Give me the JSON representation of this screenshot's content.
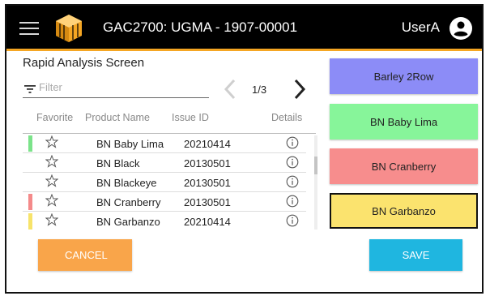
{
  "header": {
    "title": "GAC2700: UGMA - 1907-00001",
    "user": "UserA"
  },
  "screen": {
    "title": "Rapid Analysis Screen"
  },
  "filter": {
    "placeholder": "Filter"
  },
  "pager": {
    "text": "1/3"
  },
  "table": {
    "headers": [
      "Favorite",
      "Product Name",
      "Issue ID",
      "Details"
    ],
    "rows": [
      {
        "name": "BN Baby Lima",
        "issue": "20210414",
        "tag_color": "#7be38a"
      },
      {
        "name": "BN Black",
        "issue": "20130501",
        "tag_color": ""
      },
      {
        "name": "BN Blackeye",
        "issue": "20130501",
        "tag_color": ""
      },
      {
        "name": "BN Cranberry",
        "issue": "20130501",
        "tag_color": "#f48a8a"
      },
      {
        "name": "BN Garbanzo",
        "issue": "20210414",
        "tag_color": "#f7e36a"
      }
    ]
  },
  "actions": {
    "cancel": "CANCEL",
    "save": "SAVE"
  },
  "categories": [
    {
      "label": "Barley 2Row",
      "color": "#8c8cf7",
      "selected": false
    },
    {
      "label": "BN Baby Lima",
      "color": "#87f59a",
      "selected": false
    },
    {
      "label": "BN Cranberry",
      "color": "#f78d8d",
      "selected": false
    },
    {
      "label": "BN Garbanzo",
      "color": "#fbe36e",
      "selected": true
    }
  ],
  "colors": {
    "accent": "#f5a623",
    "cancel": "#f9a54a",
    "save": "#1fb6e0"
  }
}
